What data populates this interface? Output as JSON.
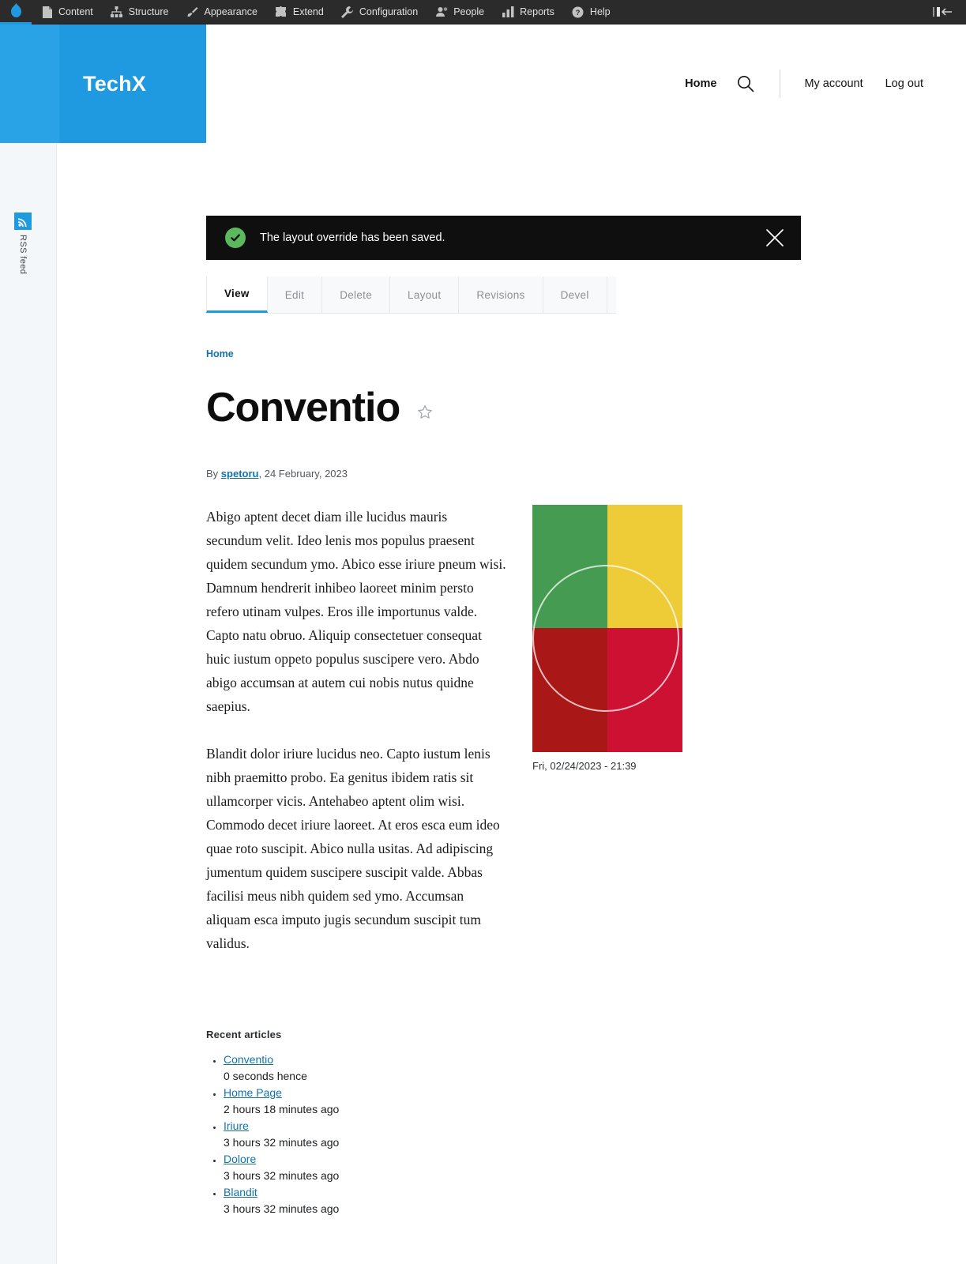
{
  "admin_toolbar": {
    "home_icon": "drupal-drop-icon",
    "items": [
      {
        "label": "Content",
        "icon": "file-icon"
      },
      {
        "label": "Structure",
        "icon": "structure-icon"
      },
      {
        "label": "Appearance",
        "icon": "paintbrush-icon"
      },
      {
        "label": "Extend",
        "icon": "puzzle-icon"
      },
      {
        "label": "Configuration",
        "icon": "wrench-icon"
      },
      {
        "label": "People",
        "icon": "people-icon"
      },
      {
        "label": "Reports",
        "icon": "bar-chart-icon"
      },
      {
        "label": "Help",
        "icon": "question-circle-icon"
      }
    ],
    "orientation_toggle_icon": "toolbar-collapse-icon"
  },
  "header": {
    "site_name": "TechX",
    "brand_color": "#1f9ae0",
    "nav": [
      {
        "label": "Home",
        "active": true
      },
      {
        "label": "My account",
        "active": false
      },
      {
        "label": "Log out",
        "active": false
      }
    ],
    "search_icon": "search-icon"
  },
  "left_rail": {
    "rss_label": "RSS feed",
    "rss_icon": "rss-icon"
  },
  "status_message": {
    "icon": "checkmark-circle-icon",
    "text": "The layout override has been saved.",
    "close_icon": "close-icon",
    "background": "#100f0f",
    "icon_color": "#5cb85c"
  },
  "tabs": [
    {
      "label": "View",
      "active": true
    },
    {
      "label": "Edit",
      "active": false
    },
    {
      "label": "Delete",
      "active": false
    },
    {
      "label": "Layout",
      "active": false
    },
    {
      "label": "Revisions",
      "active": false
    },
    {
      "label": "Devel",
      "active": false
    }
  ],
  "breadcrumb": {
    "items": [
      "Home"
    ]
  },
  "node": {
    "title": "Conventio",
    "bookmark_icon": "star-outline-icon",
    "byline_prefix": "By",
    "author": "spetoru",
    "byline_separator": ",",
    "date": "24 February, 2023",
    "paragraphs": [
      "Abigo aptent decet diam ille lucidus mauris secundum velit. Ideo lenis mos populus praesent quidem secundum ymo. Abico esse iriure pneum wisi. Damnum hendrerit inhibeo laoreet minim persto refero utinam vulpes. Eros ille importunus valde. Capto natu obruo. Aliquip consectetuer consequat huic iustum oppeto populus suscipere vero. Abdo abigo accumsan at autem cui nobis nutus quidne saepius.",
      "Blandit dolor iriure lucidus neo. Capto iustum lenis nibh praemitto probo. Ea genitus ibidem ratis sit ullamcorper vicis. Antehabeo aptent olim wisi. Commodo decet iriure laoreet. At eros esca eum ideo quae roto suscipit. Abico nulla usitas. Ad adipiscing jumentum quidem suscipere suscipit valde. Abbas facilisi meus nibh quidem sed ymo. Accumsan aliquam esca imputo jugis secundum suscipit tum validus."
    ],
    "figure": {
      "caption": "Fri, 02/24/2023 - 21:39",
      "colors": {
        "top_left": "#469b52",
        "top_right": "#edcc38",
        "bottom_left": "#a91717",
        "bottom_right": "#cc1133",
        "circle_stroke": "#ffffff"
      }
    }
  },
  "recent_articles": {
    "heading": "Recent articles",
    "items": [
      {
        "title": "Conventio",
        "time": "0 seconds hence"
      },
      {
        "title": "Home Page",
        "time": "2 hours 18 minutes ago"
      },
      {
        "title": "Iriure",
        "time": "3 hours 32 minutes ago"
      },
      {
        "title": "Dolore",
        "time": "3 hours 32 minutes ago"
      },
      {
        "title": "Blandit",
        "time": "3 hours 32 minutes ago"
      }
    ]
  }
}
